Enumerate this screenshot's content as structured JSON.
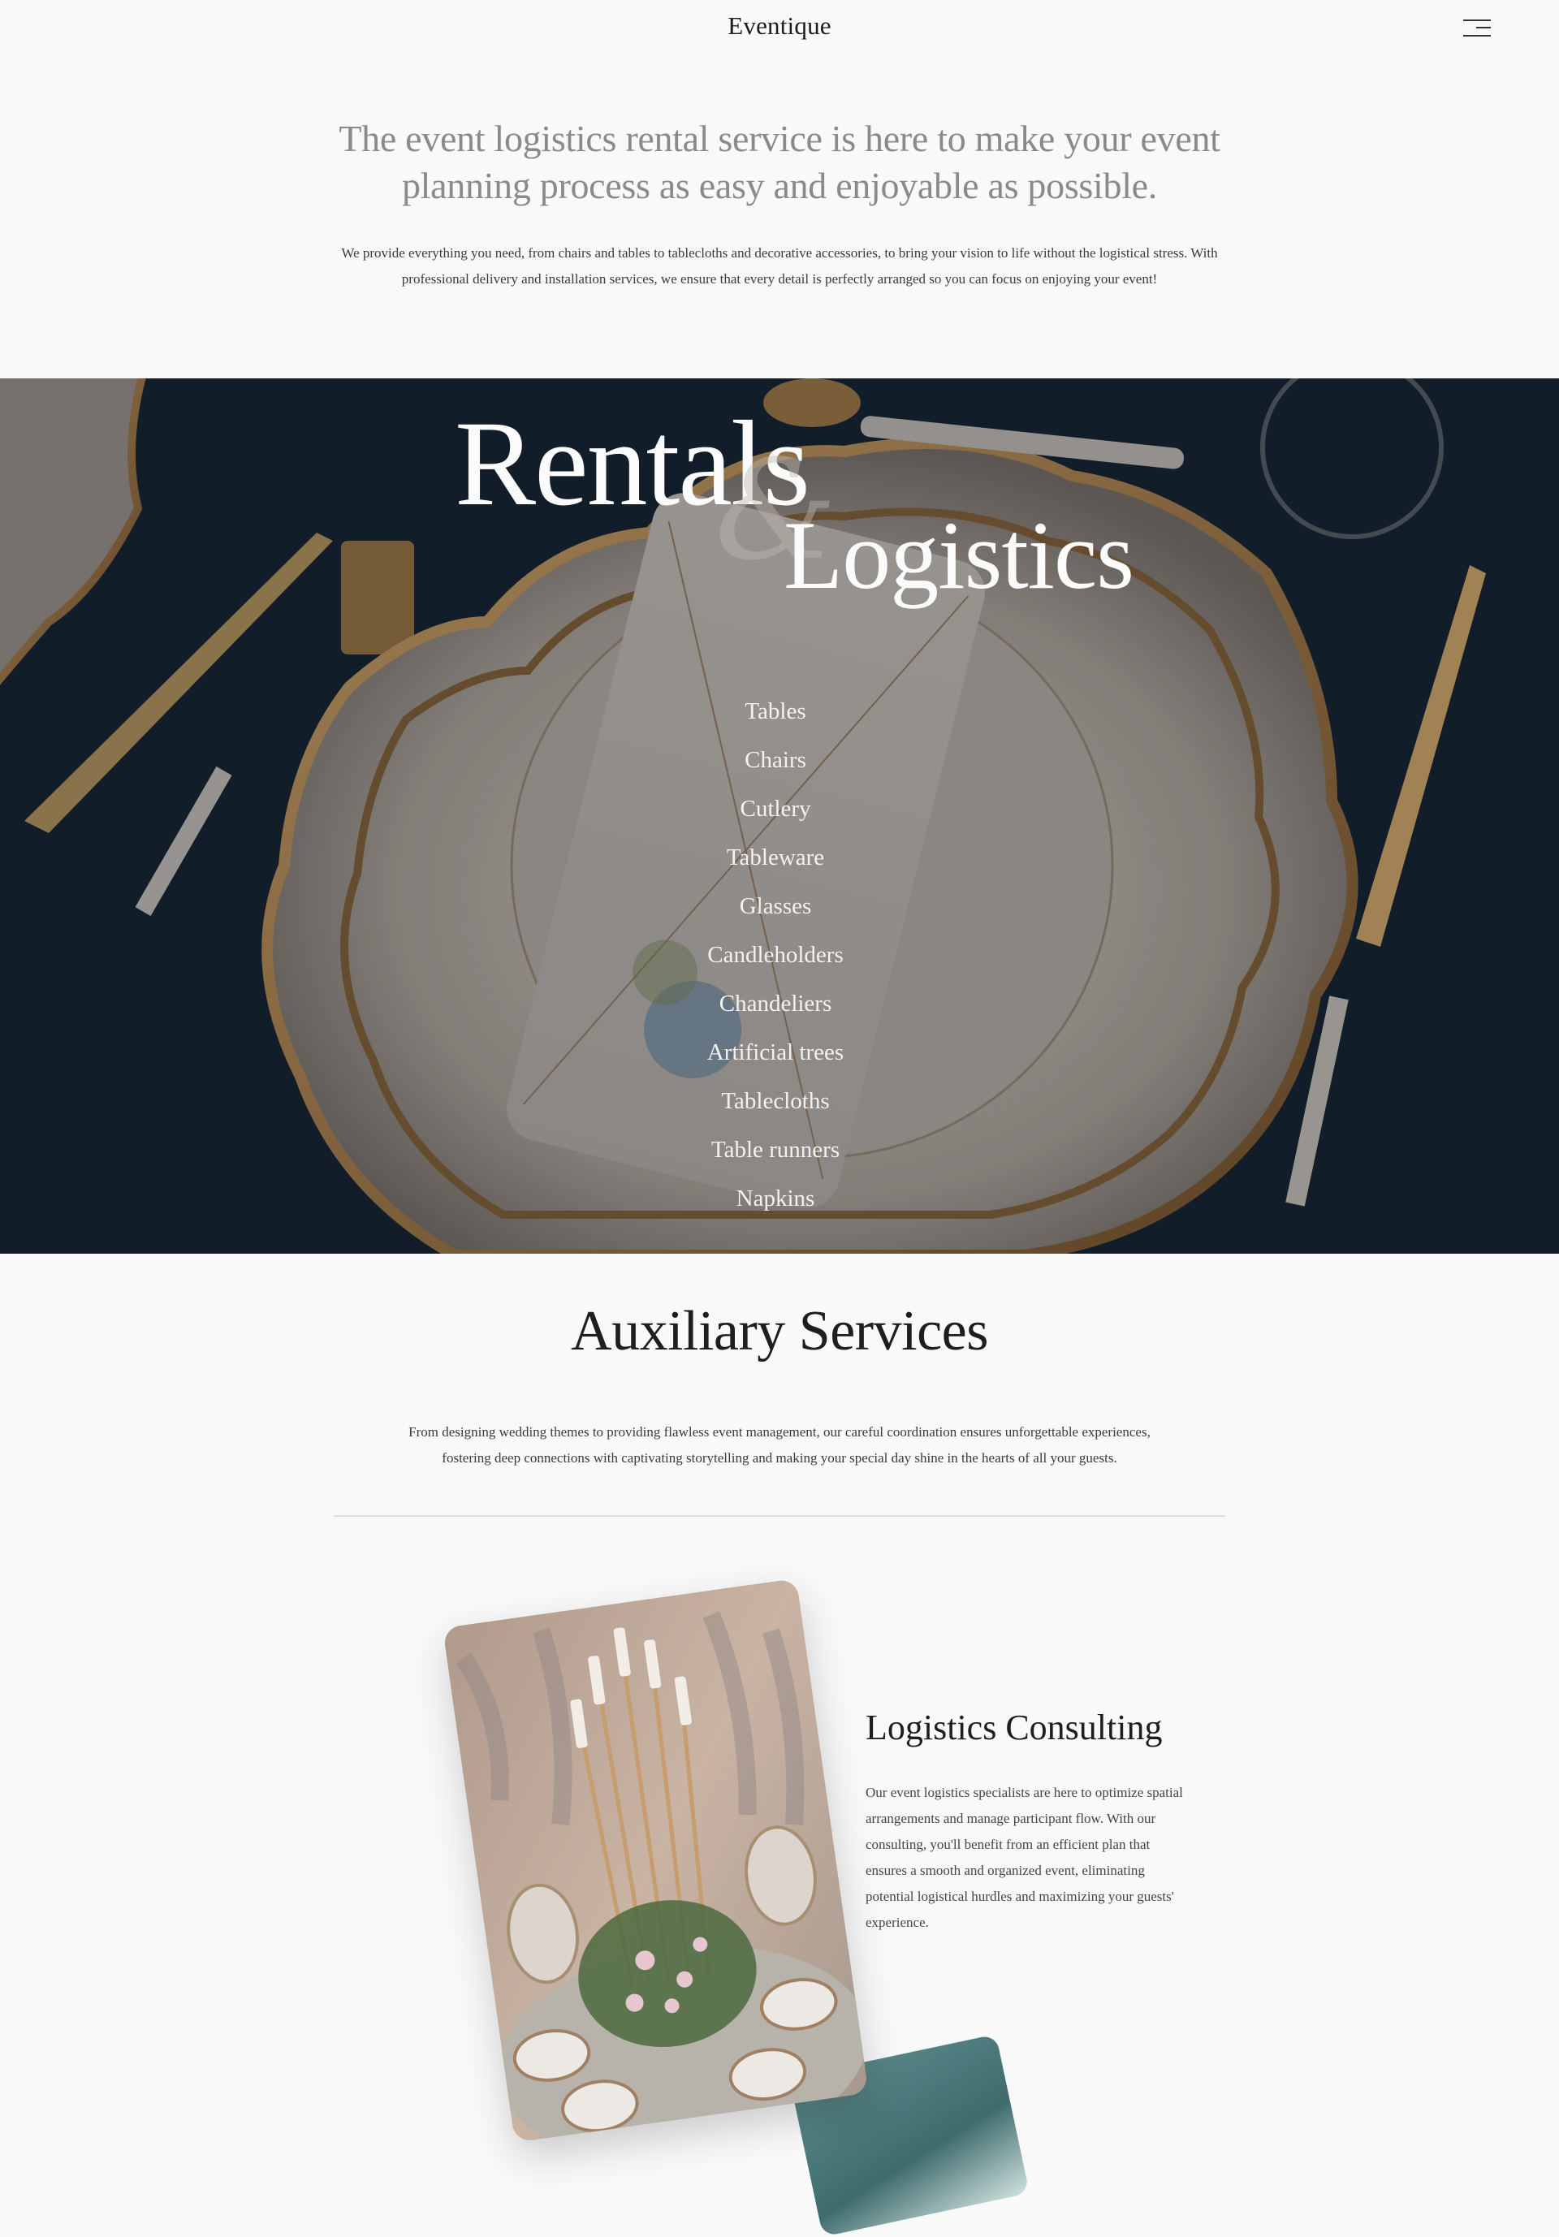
{
  "header": {
    "logo": "Eventique",
    "menu_icon": "hamburger-menu-icon"
  },
  "intro": {
    "heading": "The event logistics rental service is here to make your event planning process as easy and enjoyable as possible.",
    "body": "We provide everything you need, from chairs and tables to tablecloths and decorative accessories, to bring your vision to life without the logistical stress. With professional delivery and installation services, we ensure that every detail is perfectly arranged so you can focus on enjoying your event!"
  },
  "hero": {
    "title_line1": "Rentals",
    "ampersand": "&",
    "title_line2": "Logistics",
    "items": [
      "Tables",
      "Chairs",
      "Cutlery",
      "Tableware",
      "Glasses",
      "Candleholders",
      "Chandeliers",
      "Artificial trees",
      "Tablecloths",
      "Table runners",
      "Napkins"
    ]
  },
  "auxiliary": {
    "title": "Auxiliary Services",
    "body": "From designing wedding themes to providing flawless event management, our careful coordination ensures unforgettable experiences, fostering deep connections with captivating storytelling and making your special day shine in the hearts of all your guests."
  },
  "services": [
    {
      "title": "Logistics Consulting",
      "body": "Our event logistics specialists are here to optimize spatial arrangements and manage participant flow. With our consulting, you'll benefit from an efficient plan that ensures a smooth and organized event, eliminating potential logistical hurdles and maximizing your guests' experience."
    }
  ],
  "colors": {
    "background": "#f9f9f9",
    "heading_gray": "#8a8a8a",
    "text_dark": "#1e1e1e",
    "hero_text": "#fbfbfb"
  }
}
